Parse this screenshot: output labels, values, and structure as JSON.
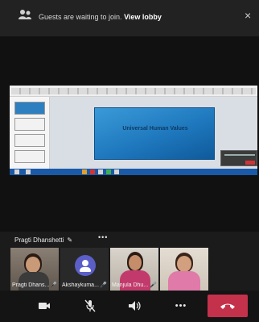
{
  "lobby_banner": {
    "message": "Guests are waiting to join.",
    "link_label": "View lobby",
    "icon": "people-icon",
    "close_icon": "close-icon"
  },
  "shared_screen": {
    "slide_title": "Universal Human Values",
    "slide_subtitle": "",
    "slide_presenter": ""
  },
  "active_speaker": {
    "name": "Pragti Dhanshetti",
    "pen_icon": "pen-icon",
    "more_label": "•••"
  },
  "participants": [
    {
      "name": "Pragti Dhans...",
      "mic_icon": "mic-on-icon",
      "type": "video"
    },
    {
      "name": "Akshaykuma...",
      "mic_icon": "mic-on-icon",
      "type": "avatar"
    },
    {
      "name": "Manjula Dhu...",
      "mic_icon": "mic-on-icon",
      "type": "video"
    },
    {
      "name": "",
      "mic_icon": "",
      "type": "video"
    }
  ],
  "controls": {
    "camera_icon": "video-camera-icon",
    "mic_icon": "mic-muted-icon",
    "speaker_icon": "speaker-icon",
    "more_label": "•••",
    "hangup_icon": "end-call-icon"
  },
  "colors": {
    "hangup": "#c4314b",
    "avatar": "#5b5fc7",
    "background": "#1b1b1b"
  }
}
